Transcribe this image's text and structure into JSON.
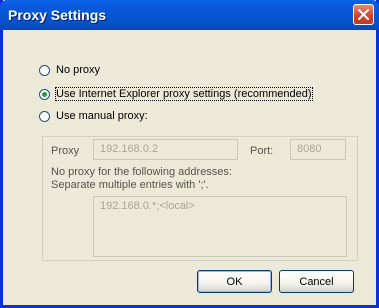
{
  "dialog": {
    "title": "Proxy Settings"
  },
  "options": [
    {
      "label": "No proxy",
      "selected": false
    },
    {
      "label": "Use Internet Explorer proxy settings (recommended)",
      "selected": true
    },
    {
      "label": "Use manual proxy:",
      "selected": false
    }
  ],
  "manual": {
    "proxy_label": "Proxy",
    "proxy_value": "192.168.0.2",
    "port_label": "Port:",
    "port_value": "8080",
    "no_proxy_line1": "No proxy for the following addresses:",
    "no_proxy_line2": "Separate multiple entries with ';'.",
    "no_proxy_value": "192.168.0.*;<local>"
  },
  "buttons": {
    "ok": "OK",
    "cancel": "Cancel"
  },
  "colors": {
    "titlebar": "#0a5ae0",
    "dialog_bg": "#ece9d8",
    "close_button": "#d5432c"
  },
  "icons": {
    "close": "close-icon"
  }
}
